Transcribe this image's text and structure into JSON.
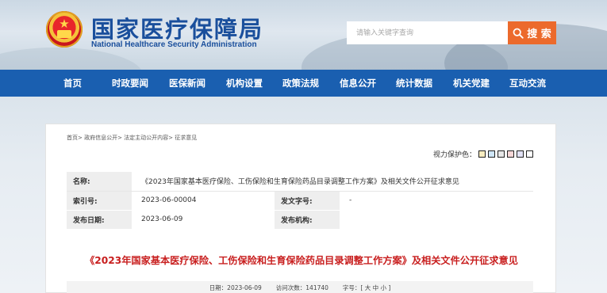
{
  "header": {
    "logo_cn": "国家医疗保障局",
    "logo_en": "National Healthcare Security Administration",
    "search_placeholder": "请输入关键字查询",
    "search_button": "搜 索"
  },
  "nav": {
    "items": [
      "首页",
      "时政要闻",
      "医保新闻",
      "机构设置",
      "政策法规",
      "信息公开",
      "统计数据",
      "机关党建",
      "互动交流"
    ]
  },
  "breadcrumb": "首页> 政府信息公开> 法定主动公开内容> 征求意见",
  "vision": {
    "label": "视力保护色：",
    "colors": [
      "#f7ecc0",
      "#cfe6f7",
      "#e7e7e7",
      "#f6d7d7",
      "#e2e2f5",
      "#ffffff"
    ]
  },
  "meta": {
    "name_label": "名称:",
    "name_value": "《2023年国家基本医疗保险、工伤保险和生育保险药品目录调整工作方案》及相关文件公开征求意见",
    "index_label": "索引号:",
    "index_value": "2023-06-00004",
    "docno_label": "发文字号:",
    "docno_value": "-",
    "date_label": "发布日期:",
    "date_value": "2023-06-09",
    "org_label": "发布机构:",
    "org_value": ""
  },
  "doc_title": "《2023年国家基本医疗保险、工伤保险和生育保险药品目录调整工作方案》及相关文件公开征求意见",
  "info": {
    "date": "日期：2023-06-09",
    "views_label": "访问次数：",
    "views": "141740",
    "font_label": "字号：[ 大 中 小 ]"
  }
}
